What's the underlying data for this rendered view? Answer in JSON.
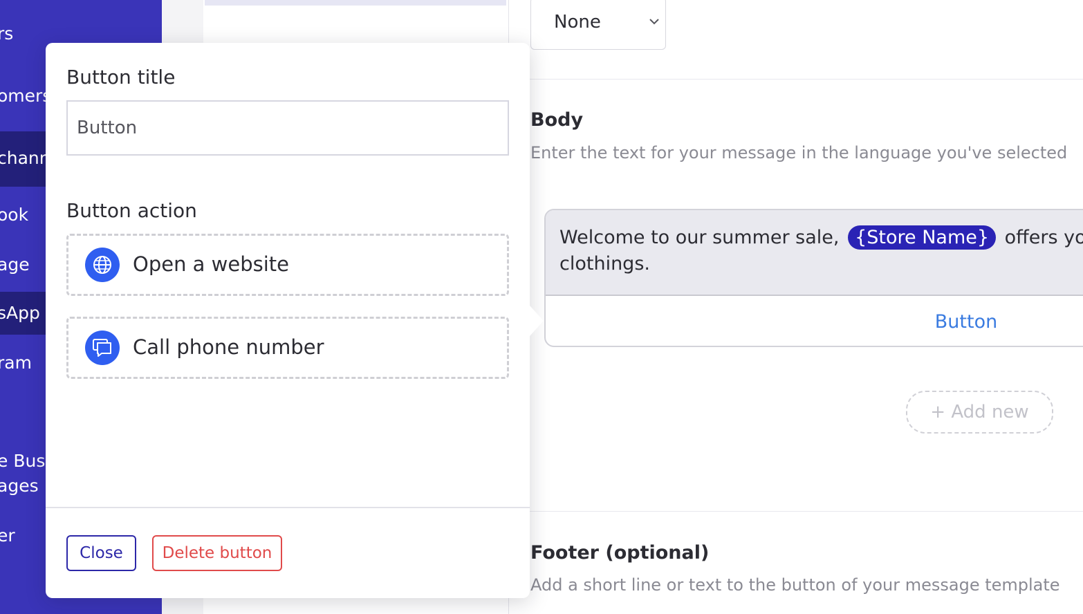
{
  "sidebar": {
    "items": [
      {
        "label": "rs",
        "active": false
      },
      {
        "label": "omers",
        "active": false
      },
      {
        "label": "channe",
        "active": true
      },
      {
        "label": "ook",
        "active": false
      },
      {
        "label": "age",
        "active": false
      },
      {
        "label": "sApp",
        "active": true
      },
      {
        "label": "ram",
        "active": false
      },
      {
        "label": "e Bus",
        "active": false
      },
      {
        "label": "ages",
        "active": false
      },
      {
        "label": "er",
        "active": false
      }
    ]
  },
  "header_select": {
    "value": "None",
    "icon": "chevron-down-icon"
  },
  "body_section": {
    "title": "Body",
    "subtitle": "Enter the text for your message in the language you've selected",
    "preview": {
      "text_before": "Welcome to our summer sale,",
      "variable_chip": "{Store Name}",
      "text_after": "offers you wide",
      "line2": "clothings.",
      "button_label": "Button"
    },
    "add_new_label": "+ Add new"
  },
  "footer_section": {
    "title": "Footer (optional)",
    "subtitle": "Add a short line or text to the button of your message template"
  },
  "modal": {
    "title_label": "Button title",
    "title_value": "Button",
    "action_label": "Button action",
    "actions": [
      {
        "label": "Open a website",
        "icon": "globe-icon"
      },
      {
        "label": "Call phone number",
        "icon": "chat-icon"
      }
    ],
    "close_label": "Close",
    "delete_label": "Delete button"
  },
  "colors": {
    "sidebar": "#3a34b8",
    "sidebar_active": "#23207a",
    "accent": "#2f5ef0",
    "chip": "#2a23b5",
    "danger": "#e04a4a",
    "link": "#3a7be0"
  }
}
